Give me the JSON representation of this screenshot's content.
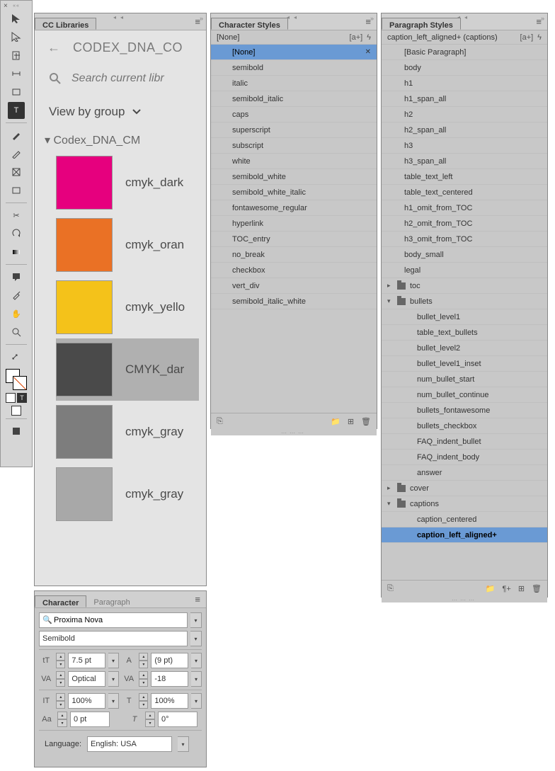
{
  "tools": {
    "T_glyph": "T"
  },
  "cc": {
    "tab": "CC Libraries",
    "title": "CODEX_DNA_CO",
    "search_placeholder": "Search current libr",
    "view_label": "View by group",
    "group_header": "Codex_DNA_CM",
    "swatches": [
      {
        "label": "cmyk_dark",
        "color": "#e6007e"
      },
      {
        "label": "cmyk_oran",
        "color": "#ea7125"
      },
      {
        "label": "cmyk_yello",
        "color": "#f4c21a"
      },
      {
        "label": "CMYK_dar",
        "color": "#4a4a4a",
        "selected": true
      },
      {
        "label": "cmyk_gray",
        "color": "#7d7d7d"
      },
      {
        "label": "cmyk_gray",
        "color": "#a8a8a8"
      }
    ]
  },
  "char_styles": {
    "tab": "Character Styles",
    "current": "[None]",
    "items": [
      "[None]",
      "semibold",
      "italic",
      "semibold_italic",
      "caps",
      "superscript",
      "subscript",
      "white",
      "semibold_white",
      "semibold_white_italic",
      "fontawesome_regular",
      "hyperlink",
      "TOC_entry",
      "no_break",
      "checkbox",
      "vert_div",
      "semibold_italic_white"
    ],
    "selected_index": 0
  },
  "para_styles": {
    "tab": "Paragraph Styles",
    "current": "caption_left_aligned+ (captions)",
    "tree": [
      {
        "t": "item",
        "lvl": 1,
        "label": "[Basic Paragraph]"
      },
      {
        "t": "item",
        "lvl": 1,
        "label": "body"
      },
      {
        "t": "item",
        "lvl": 1,
        "label": "h1"
      },
      {
        "t": "item",
        "lvl": 1,
        "label": "h1_span_all"
      },
      {
        "t": "item",
        "lvl": 1,
        "label": "h2"
      },
      {
        "t": "item",
        "lvl": 1,
        "label": "h2_span_all"
      },
      {
        "t": "item",
        "lvl": 1,
        "label": "h3"
      },
      {
        "t": "item",
        "lvl": 1,
        "label": "h3_span_all"
      },
      {
        "t": "item",
        "lvl": 1,
        "label": "table_text_left"
      },
      {
        "t": "item",
        "lvl": 1,
        "label": "table_text_centered"
      },
      {
        "t": "item",
        "lvl": 1,
        "label": "h1_omit_from_TOC"
      },
      {
        "t": "item",
        "lvl": 1,
        "label": "h2_omit_from_TOC"
      },
      {
        "t": "item",
        "lvl": 1,
        "label": "h3_omit_from_TOC"
      },
      {
        "t": "item",
        "lvl": 1,
        "label": "body_small"
      },
      {
        "t": "item",
        "lvl": 1,
        "label": "legal"
      },
      {
        "t": "grp",
        "open": false,
        "label": "toc"
      },
      {
        "t": "grp",
        "open": true,
        "label": "bullets"
      },
      {
        "t": "item",
        "lvl": 2,
        "label": "bullet_level1"
      },
      {
        "t": "item",
        "lvl": 2,
        "label": "table_text_bullets"
      },
      {
        "t": "item",
        "lvl": 2,
        "label": "bullet_level2"
      },
      {
        "t": "item",
        "lvl": 2,
        "label": "bullet_level1_inset"
      },
      {
        "t": "item",
        "lvl": 2,
        "label": "num_bullet_start"
      },
      {
        "t": "item",
        "lvl": 2,
        "label": "num_bullet_continue"
      },
      {
        "t": "item",
        "lvl": 2,
        "label": "bullets_fontawesome"
      },
      {
        "t": "item",
        "lvl": 2,
        "label": "bullets_checkbox"
      },
      {
        "t": "item",
        "lvl": 2,
        "label": "FAQ_indent_bullet"
      },
      {
        "t": "item",
        "lvl": 2,
        "label": "FAQ_indent_body"
      },
      {
        "t": "item",
        "lvl": 2,
        "label": "answer"
      },
      {
        "t": "grp",
        "open": false,
        "label": "cover"
      },
      {
        "t": "grp",
        "open": true,
        "label": "captions"
      },
      {
        "t": "item",
        "lvl": 2,
        "label": "caption_centered"
      },
      {
        "t": "item",
        "lvl": 2,
        "label": "caption_left_aligned+",
        "selected": true
      }
    ]
  },
  "char_panel": {
    "tab_char": "Character",
    "tab_para": "Paragraph",
    "font_family": "Proxima Nova",
    "font_style": "Semibold",
    "labels": {
      "size": "tT",
      "leading": "A",
      "kerning": "VA",
      "tracking": "VA",
      "vscale": "IT",
      "hscale": "T",
      "baseline": "Aa",
      "skew": "T"
    },
    "size": "7.5 pt",
    "leading": "(9 pt)",
    "kerning": "Optical",
    "tracking": "-18",
    "vscale": "100%",
    "hscale": "100%",
    "baseline": "0 pt",
    "skew": "0°",
    "language_label": "Language:",
    "language": "English: USA"
  }
}
